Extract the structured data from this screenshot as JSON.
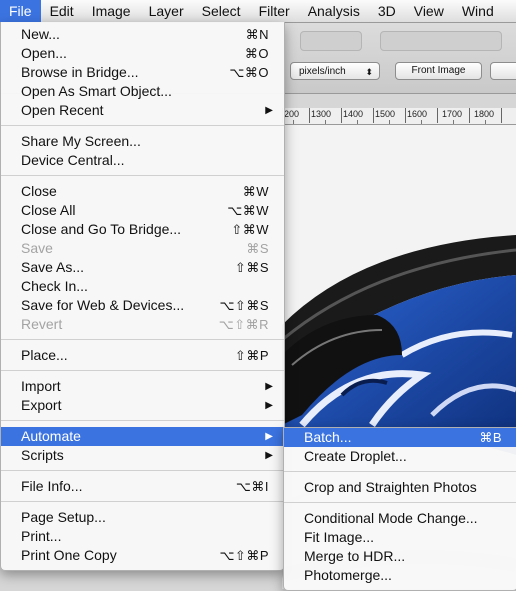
{
  "menubar": {
    "items": [
      {
        "label": "File",
        "active": true
      },
      {
        "label": "Edit"
      },
      {
        "label": "Image"
      },
      {
        "label": "Layer"
      },
      {
        "label": "Select"
      },
      {
        "label": "Filter"
      },
      {
        "label": "Analysis"
      },
      {
        "label": "3D"
      },
      {
        "label": "View"
      },
      {
        "label": "Wind"
      }
    ]
  },
  "toolbar": {
    "resolution_unit": "pixels/inch",
    "front_image_label": "Front Image"
  },
  "ruler": {
    "labels": [
      "200",
      "1300",
      "1400",
      "1500",
      "1600",
      "1700",
      "1800"
    ]
  },
  "file_menu": {
    "items": [
      {
        "label": "New...",
        "shortcut": "⌘N"
      },
      {
        "label": "Open...",
        "shortcut": "⌘O"
      },
      {
        "label": "Browse in Bridge...",
        "shortcut": "⌥⌘O"
      },
      {
        "label": "Open As Smart Object...",
        "shortcut": ""
      },
      {
        "label": "Open Recent",
        "submenu": true
      },
      {
        "label": "Share My Screen...",
        "shortcut": ""
      },
      {
        "label": "Device Central...",
        "shortcut": ""
      },
      {
        "label": "Close",
        "shortcut": "⌘W"
      },
      {
        "label": "Close All",
        "shortcut": "⌥⌘W"
      },
      {
        "label": "Close and Go To Bridge...",
        "shortcut": "⇧⌘W"
      },
      {
        "label": "Save",
        "shortcut": "⌘S",
        "disabled": true
      },
      {
        "label": "Save As...",
        "shortcut": "⇧⌘S"
      },
      {
        "label": "Check In...",
        "shortcut": ""
      },
      {
        "label": "Save for Web & Devices...",
        "shortcut": "⌥⇧⌘S"
      },
      {
        "label": "Revert",
        "shortcut": "⌥⇧⌘R",
        "disabled": true
      },
      {
        "label": "Place...",
        "shortcut": "⇧⌘P"
      },
      {
        "label": "Import",
        "submenu": true
      },
      {
        "label": "Export",
        "submenu": true
      },
      {
        "label": "Automate",
        "submenu": true,
        "highlighted": true
      },
      {
        "label": "Scripts",
        "submenu": true
      },
      {
        "label": "File Info...",
        "shortcut": "⌥⌘I"
      },
      {
        "label": "Page Setup...",
        "shortcut": ""
      },
      {
        "label": "Print...",
        "shortcut": ""
      },
      {
        "label": "Print One Copy",
        "shortcut": "⌥⇧⌘P"
      }
    ]
  },
  "automate_menu": {
    "items": [
      {
        "label": "Batch...",
        "shortcut": "⌘B",
        "highlighted": true
      },
      {
        "label": "Create Droplet..."
      },
      {
        "label": "Crop and Straighten Photos"
      },
      {
        "label": "Conditional Mode Change..."
      },
      {
        "label": "Fit Image..."
      },
      {
        "label": "Merge to HDR..."
      },
      {
        "label": "Photomerge..."
      }
    ]
  },
  "colors": {
    "highlight": "#3b73e0",
    "disabled_text": "#a3a3a3",
    "image_blue": "#1f4fb0"
  },
  "icons": {
    "submenu_arrow": "triangle-right-icon",
    "select_arrows": "updown-arrows-icon"
  }
}
